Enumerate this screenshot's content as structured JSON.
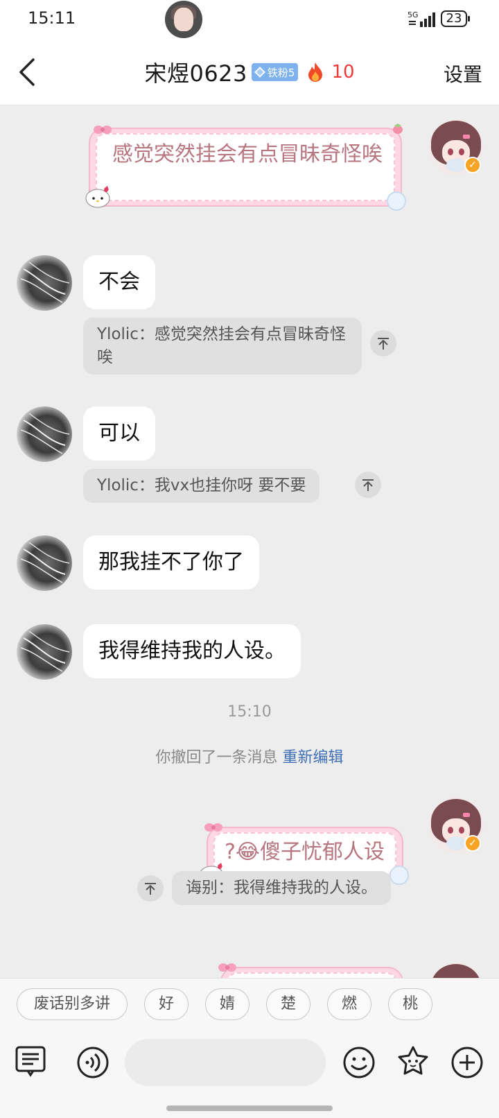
{
  "status_bar": {
    "time": "15:11",
    "network": "5G",
    "battery": "23"
  },
  "header": {
    "title": "宋煜0623",
    "fan_badge": "铁粉5",
    "fire_count": "10",
    "settings": "设置"
  },
  "messages": {
    "m1": {
      "text": "感觉突然挂会有点冒昧奇怪唉"
    },
    "m2": {
      "text": "不会",
      "quote": "Ylolic：感觉突然挂会有点冒昧奇怪唉"
    },
    "m3": {
      "text": "可以",
      "quote": "Ylolic：我vx也挂你呀 要不要"
    },
    "m4": {
      "text": "那我挂不了你了"
    },
    "m5": {
      "text": "我得维持我的人设。"
    },
    "timestamp": "15:10",
    "recall_notice": "你撤回了一条消息",
    "recall_edit": "重新编辑",
    "m6": {
      "text": "?😂傻子忧郁人设",
      "quote": "诲别：我得维持我的人设。"
    }
  },
  "quick_replies": [
    "废话别多讲",
    "好",
    "婧",
    "楚",
    "燃",
    "桃"
  ],
  "input": {
    "placeholder": ""
  },
  "colors": {
    "accent_blue": "#3f6fb5",
    "fire_red": "#ef3a3a",
    "badge_blue": "#7db2ee",
    "sticker_pink": "#fdd7e4"
  },
  "icons": [
    "back-icon",
    "diamond-icon",
    "fire-icon",
    "pin-icon",
    "keyboard-icon",
    "voice-icon",
    "emoji-icon",
    "sticker-icon",
    "plus-icon"
  ]
}
